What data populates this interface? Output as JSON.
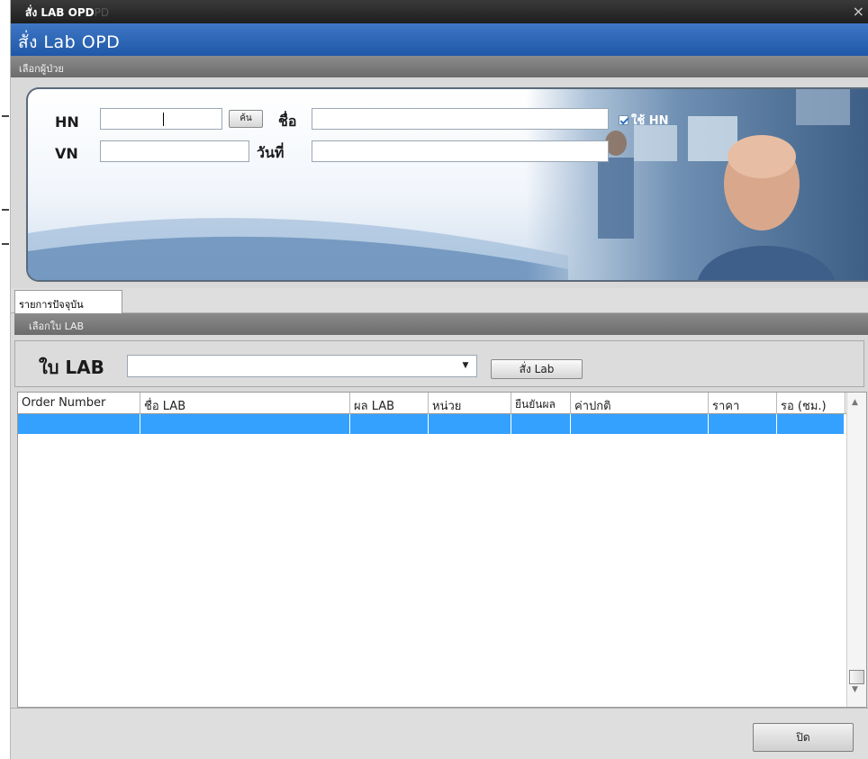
{
  "window": {
    "title": "สั่ง LAB OPD",
    "title_ghost": "PD",
    "close_glyph": "×"
  },
  "form": {
    "title": "สั่ง Lab OPD"
  },
  "patient_group": {
    "title": "เลือกผู้ป่วย"
  },
  "patient": {
    "hn_label": "HN",
    "hn_value": "",
    "search_label": "ค้น",
    "name_label": "ชื่อ",
    "name_value": "",
    "use_hn_label": "ใช้ HN",
    "use_hn_checked": true,
    "vn_label": "VN",
    "vn_value": "",
    "date_label": "วันที่",
    "date_value": ""
  },
  "tabs": [
    {
      "label": "รายการปัจจุบัน",
      "active": true
    }
  ],
  "lab_group": {
    "title": "เลือกใบ LAB"
  },
  "lab": {
    "label": "ใบ LAB",
    "selected": "",
    "order_button": "สั่ง Lab"
  },
  "grid": {
    "columns": [
      "Order Number",
      "ชื่อ LAB",
      "ผล LAB",
      "หน่วย",
      "ยืนยันผล",
      "ค่าปกติ",
      "ราคา",
      "รอ (ชม.)"
    ],
    "rows": [
      [
        "",
        "",
        "",
        "",
        "",
        "",
        "",
        ""
      ]
    ],
    "selected_row_color": "#35a1ff"
  },
  "footer": {
    "close_button": "ปิด"
  },
  "colors": {
    "title_bar": "#2a2a2a",
    "form_header": "#2c64b4",
    "group_header": "#7a7a7a"
  },
  "icons": {
    "combo_arrow": "chevron-down-icon",
    "scroll_up": "chevron-up-icon",
    "scroll_down": "chevron-down-icon"
  }
}
